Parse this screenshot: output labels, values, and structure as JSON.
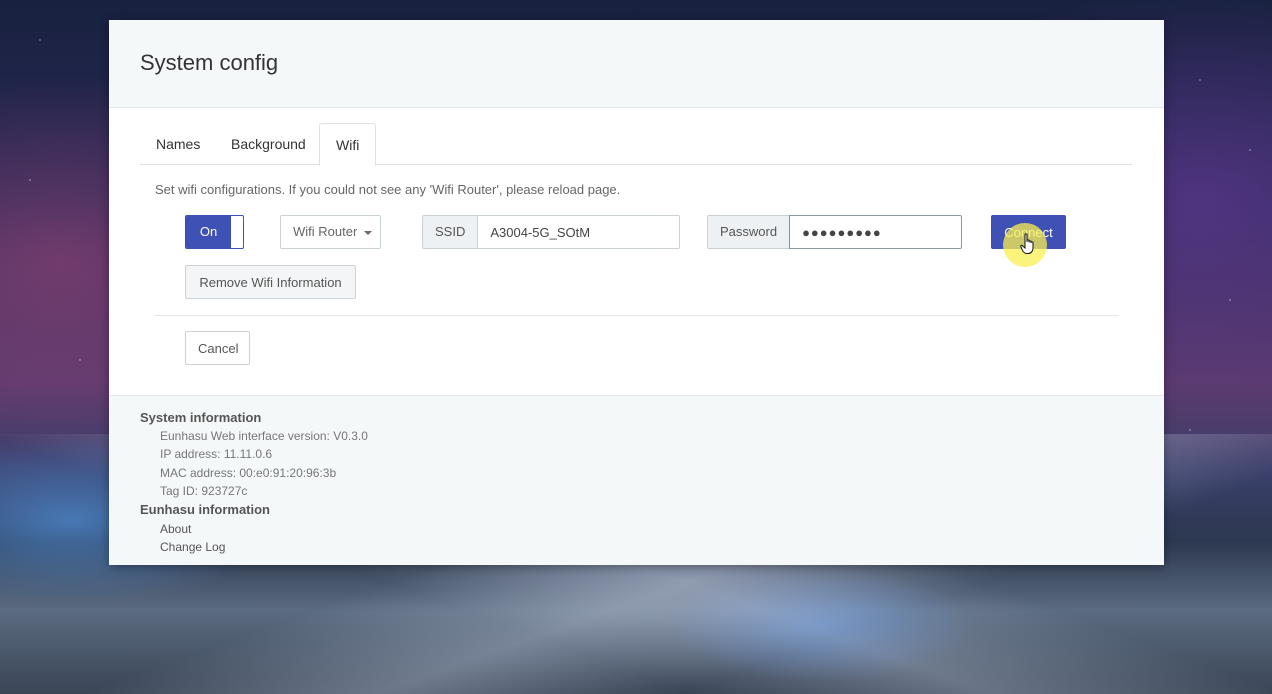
{
  "header": {
    "title": "System config"
  },
  "tabs": [
    {
      "label": "Names",
      "active": false
    },
    {
      "label": "Background",
      "active": false
    },
    {
      "label": "Wifi",
      "active": true
    }
  ],
  "wifi": {
    "help_text": "Set wifi configurations. If you could not see any 'Wifi Router', please reload page.",
    "toggle_label": "On",
    "router_dropdown_label": "Wifi Router",
    "ssid_label": "SSID",
    "ssid_value": "A3004-5G_SOtM",
    "password_label": "Password",
    "password_value": "●●●●●●●●●",
    "connect_label": "Connect",
    "remove_label": "Remove Wifi Information",
    "cancel_label": "Cancel"
  },
  "footer": {
    "system_heading": "System information",
    "system_lines": [
      "Eunhasu Web interface version: V0.3.0",
      "IP address: 11.11.0.6",
      "MAC address: 00:e0:91:20:96:3b",
      "Tag ID: 923727c"
    ],
    "eunhasu_heading": "Eunhasu information",
    "links": [
      "About",
      "Change Log"
    ]
  },
  "colors": {
    "accent": "#3f51b5",
    "cursor_highlight": "#faf050"
  },
  "icons": [
    "caret-down-icon",
    "hand-pointer-icon"
  ]
}
